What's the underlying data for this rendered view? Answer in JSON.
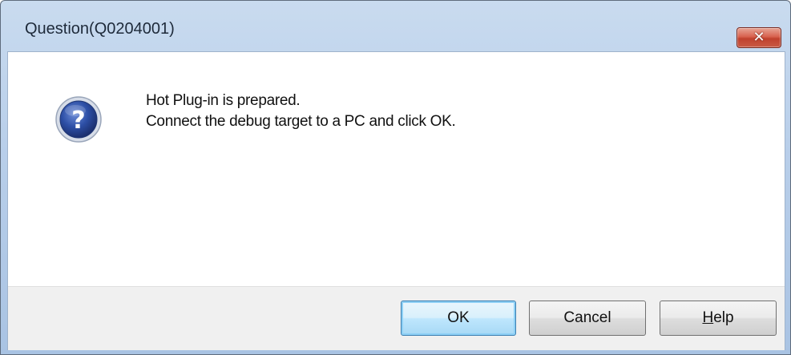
{
  "window": {
    "title": "Question(Q0204001)",
    "close_icon": "close-icon"
  },
  "message": {
    "icon": "question-icon",
    "line1": "Hot Plug-in is prepared.",
    "line2": "Connect the debug target to a PC and click OK."
  },
  "buttons": {
    "ok": "OK",
    "cancel": "Cancel",
    "help_mnemonic": "H",
    "help_rest": "elp"
  },
  "colors": {
    "titlebar": "#b9cfea",
    "close_button": "#d8624e",
    "default_button_focus": "#3c7fb1",
    "button_bar": "#f0f0f0"
  }
}
